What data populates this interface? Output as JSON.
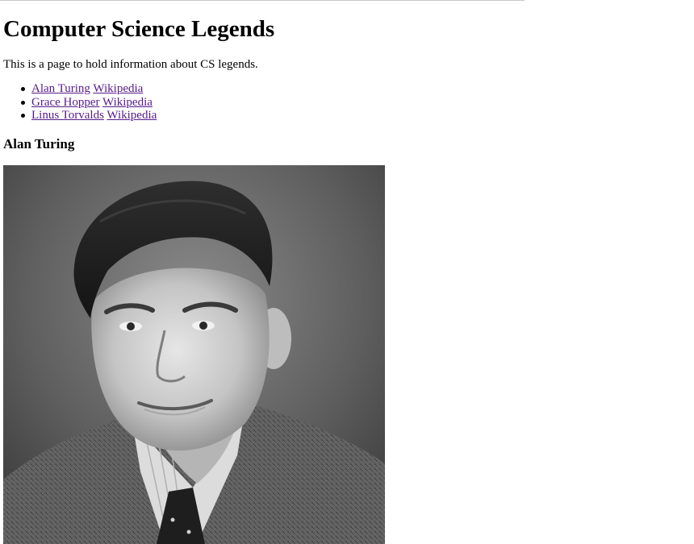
{
  "page": {
    "title": "Computer Science Legends",
    "intro": "This is a page to hold information about CS legends."
  },
  "legends": [
    {
      "name": "Alan Turing",
      "wiki_label": "Wikipedia"
    },
    {
      "name": "Grace Hopper",
      "wiki_label": "Wikipedia"
    },
    {
      "name": "Linus Torvalds",
      "wiki_label": "Wikipedia"
    }
  ],
  "section": {
    "heading": "Alan Turing",
    "image": "portrait of Alan Turing (black and white photo)"
  },
  "colors": {
    "visited_link": "#551a8b",
    "text": "#000000",
    "background": "#ffffff"
  }
}
